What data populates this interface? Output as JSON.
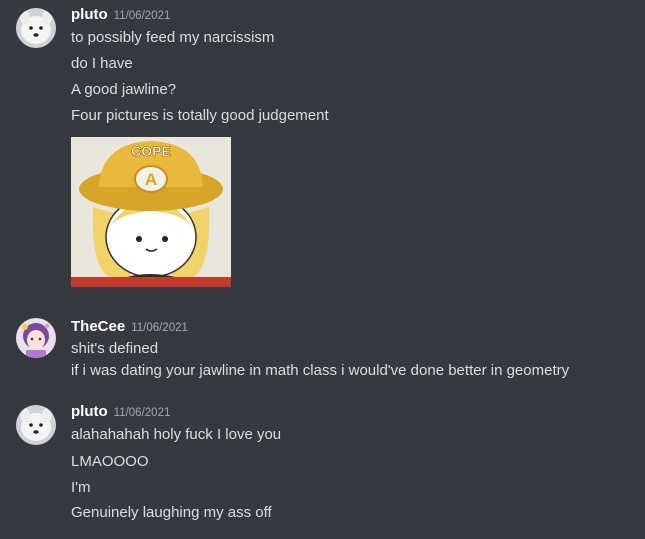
{
  "messages": [
    {
      "username": "pluto",
      "timestamp": "11/06/2021",
      "lines": [
        "to possibly feed my narcissism",
        "do I have",
        "A good jawline?",
        "Four pictures is totally good judgement"
      ],
      "attachment": {
        "caption_text": "COPE",
        "emblem_letter": "A"
      }
    },
    {
      "username": "TheCee",
      "timestamp": "11/06/2021",
      "lines": [
        "shit's defined",
        "if i was dating your jawline in math class i would've done better in geometry"
      ]
    },
    {
      "username": "pluto",
      "timestamp": "11/06/2021",
      "lines": [
        "alahahahah holy fuck I love you",
        "LMAOOOO",
        "I'm",
        "Genuinely laughing my ass off"
      ]
    }
  ],
  "colors": {
    "background": "#36393f",
    "username": "#ffffff",
    "message_text": "#dcddde",
    "timestamp": "#a3a6aa"
  }
}
